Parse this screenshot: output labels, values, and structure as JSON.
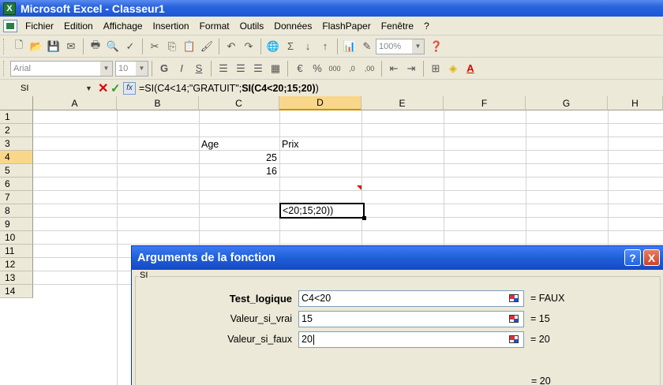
{
  "app": {
    "title": "Microsoft Excel - Classeur1",
    "logo_text": "X"
  },
  "menu": [
    "Fichier",
    "Edition",
    "Affichage",
    "Insertion",
    "Format",
    "Outils",
    "Données",
    "FlashPaper",
    "Fenêtre",
    "?"
  ],
  "toolbar": {
    "zoom": "100%",
    "font_name": "Arial",
    "font_size": "10"
  },
  "formula_bar": {
    "name_box": "SI",
    "formula_prefix": "=SI(C4<14;\"GRATUIT\";",
    "formula_bold": "SI(C4<20;15;20)",
    "formula_suffix": ")"
  },
  "sheet": {
    "columns": [
      "A",
      "B",
      "C",
      "D",
      "E",
      "F",
      "G",
      "H"
    ],
    "rows": [
      "1",
      "2",
      "3",
      "4",
      "5",
      "6",
      "7",
      "8",
      "9",
      "10",
      "11",
      "12",
      "13",
      "14"
    ],
    "active_column": "D",
    "active_row": "4",
    "cells": {
      "C3": "Age",
      "D3": "Prix",
      "C4": "25",
      "C5": "16",
      "D4_edit": "<20;15;20))"
    }
  },
  "dialog": {
    "title": "Arguments de la fonction",
    "group_label": "SI",
    "args": [
      {
        "label": "Test_logique",
        "value": "C4<20",
        "result": "= FAUX"
      },
      {
        "label": "Valeur_si_vrai",
        "value": "15",
        "result": "= 15"
      },
      {
        "label": "Valeur_si_faux",
        "value": "20",
        "result": "= 20"
      }
    ],
    "final_result": "= 20",
    "help_label": "?",
    "close_label": "X"
  }
}
